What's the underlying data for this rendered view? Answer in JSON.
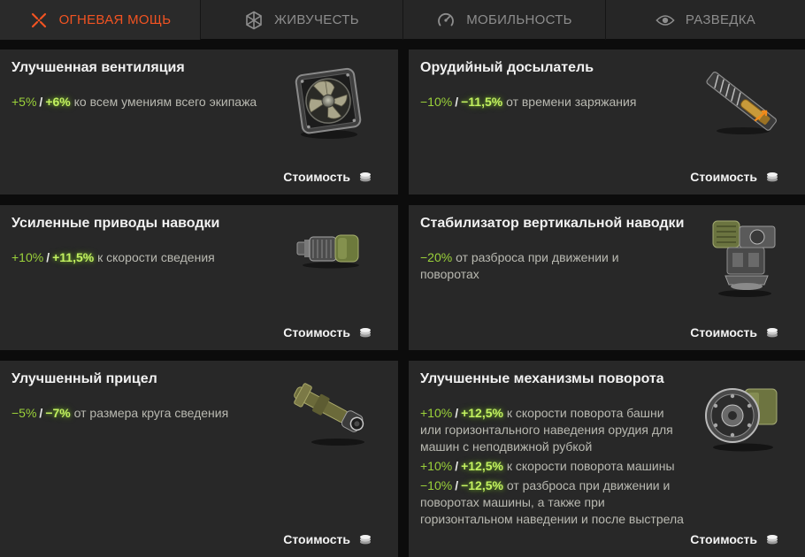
{
  "tabs": [
    {
      "label": "ОГНЕВАЯ МОЩЬ",
      "icon": "crossed-swords-icon",
      "active": true
    },
    {
      "label": "ЖИВУЧЕСТЬ",
      "icon": "armor-hex-icon",
      "active": false
    },
    {
      "label": "МОБИЛЬНОСТЬ",
      "icon": "speedometer-icon",
      "active": false
    },
    {
      "label": "РАЗВЕДКА",
      "icon": "eye-icon",
      "active": false
    }
  ],
  "colors": {
    "accent": "#f25322",
    "value_base": "#9bd23a",
    "value_improved": "#c2f060",
    "card_bg": "#282828",
    "page_bg": "#0c0c0c"
  },
  "cost_label": "Стоимость",
  "cards": [
    {
      "title": "Улучшенная вентиляция",
      "image": "ventilation-fan-icon",
      "effects": [
        {
          "base": "+5%",
          "sep": "/",
          "improved": "+6%",
          "text": "ко всем умениям всего экипажа"
        }
      ]
    },
    {
      "title": "Орудийный досылатель",
      "image": "gun-rammer-icon",
      "effects": [
        {
          "base": "−10%",
          "sep": "/",
          "improved": "−11,5%",
          "text": "от времени заряжания"
        }
      ]
    },
    {
      "title": "Усиленные приводы наводки",
      "image": "gun-laying-drive-icon",
      "effects": [
        {
          "base": "+10%",
          "sep": "/",
          "improved": "+11,5%",
          "text": "к скорости сведения"
        }
      ]
    },
    {
      "title": "Стабилизатор вертикальной наводки",
      "image": "vertical-stabilizer-icon",
      "effects": [
        {
          "base": "−20%",
          "sep": "",
          "improved": "",
          "text": "от разброса при движении и поворотах"
        }
      ]
    },
    {
      "title": "Улучшенный прицел",
      "image": "gun-sight-icon",
      "effects": [
        {
          "base": "−5%",
          "sep": "/",
          "improved": "−7%",
          "text": "от размера круга сведения"
        }
      ]
    },
    {
      "title": "Улучшенные механизмы поворота",
      "image": "turning-mechanism-icon",
      "effects": [
        {
          "base": "+10%",
          "sep": "/",
          "improved": "+12,5%",
          "text": "к скорости поворота башни или горизонтального наведения орудия для машин с неподвижной рубкой"
        },
        {
          "base": "+10%",
          "sep": "/",
          "improved": "+12,5%",
          "text": "к скорости поворота машины"
        },
        {
          "base": "−10%",
          "sep": "/",
          "improved": "−12,5%",
          "text": "от разброса при движении и поворотах машины, а также при горизонтальном наведении и после выстрела"
        }
      ]
    }
  ]
}
